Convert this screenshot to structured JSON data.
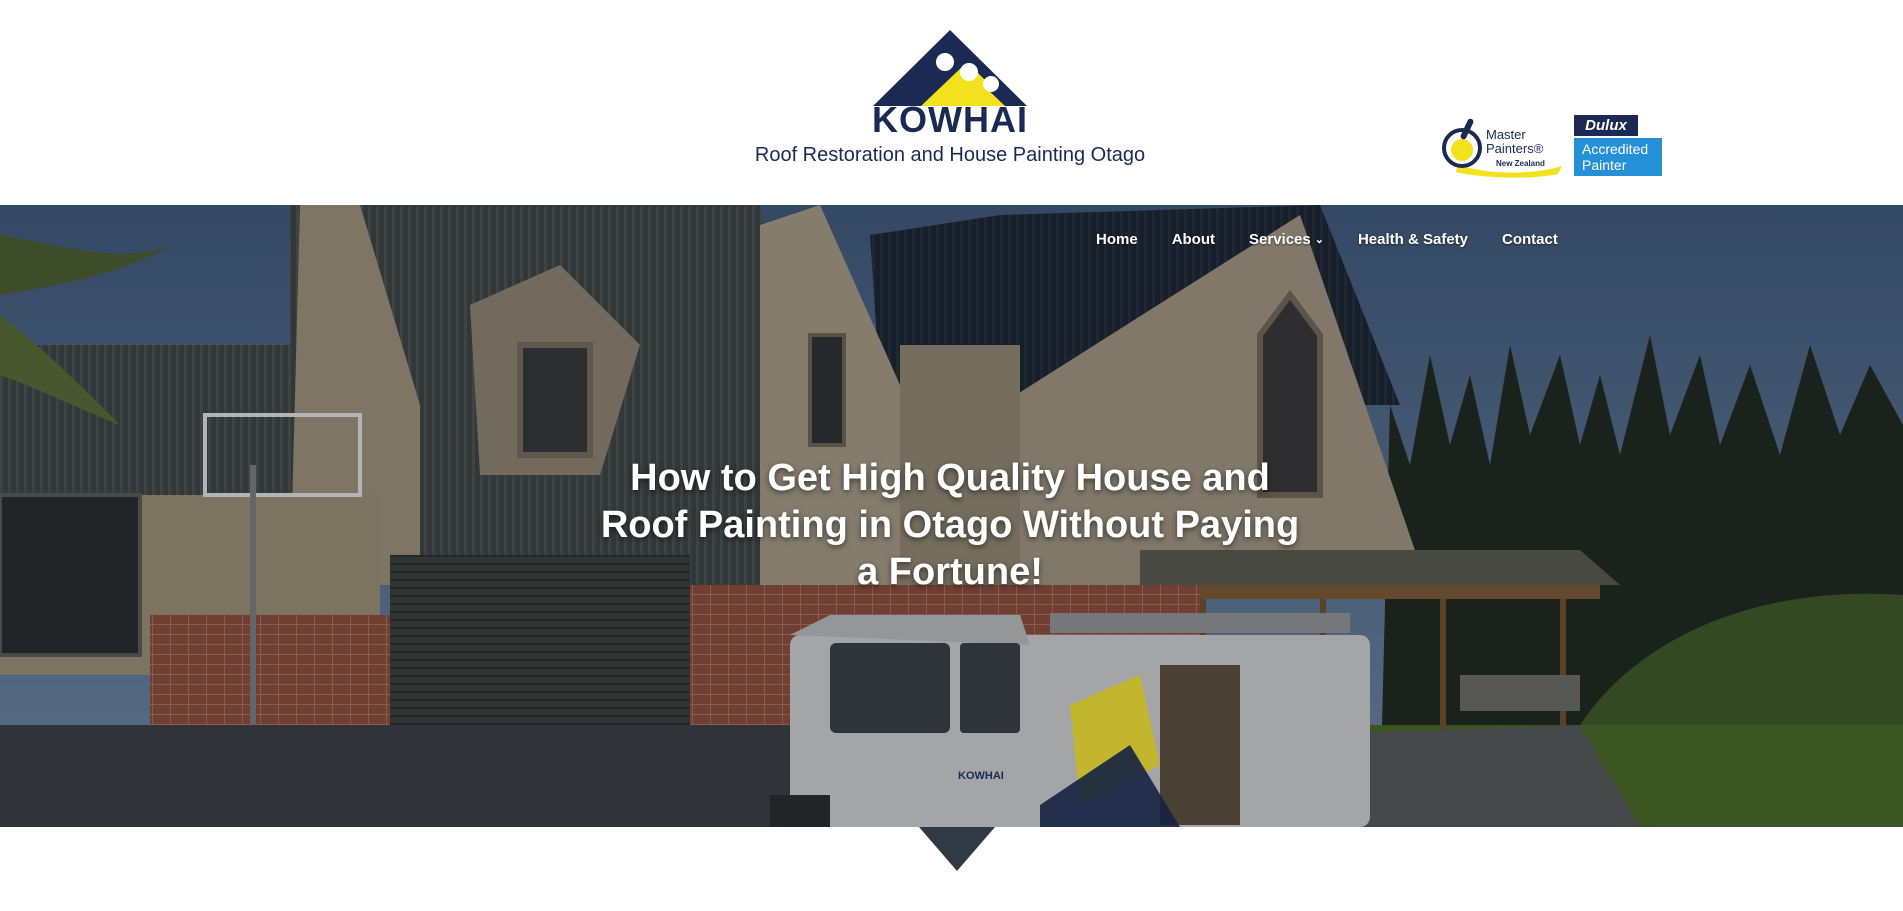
{
  "header": {
    "logo_text": "KOWHAI",
    "tagline": "Roof Restoration and House Painting Otago",
    "badges": {
      "master_painters": {
        "line1": "Master",
        "line2": "Painters®",
        "line3": "New Zealand"
      },
      "dulux": {
        "brand": "Dulux",
        "line1": "Accredited",
        "line2": "Painter"
      }
    }
  },
  "nav": {
    "items": [
      {
        "label": "Home"
      },
      {
        "label": "About"
      },
      {
        "label": "Services",
        "has_dropdown": true
      },
      {
        "label": "Health & Safety"
      },
      {
        "label": "Contact"
      }
    ],
    "dropdown_icon": "chevron-down-icon"
  },
  "hero": {
    "headline": "How to Get High Quality House and Roof Painting in Otago Without Paying a Fortune!"
  },
  "van": {
    "logo_text": "KOWHAI"
  },
  "colors": {
    "navy": "#1b2a52",
    "yellow": "#f2e21e",
    "dulux_blue": "#2590d6",
    "white": "#ffffff"
  }
}
